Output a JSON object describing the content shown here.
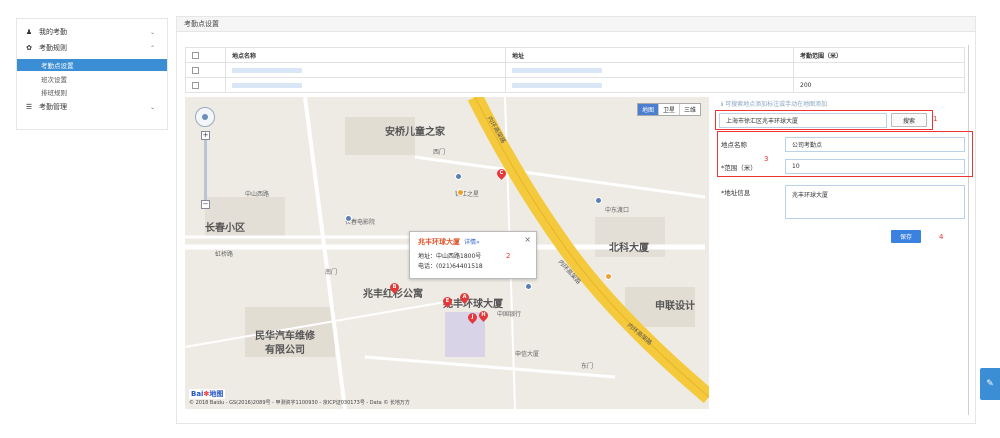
{
  "sidebar": {
    "items": [
      {
        "label": "我的考勤",
        "icon": "user-icon"
      },
      {
        "label": "考勤规则",
        "icon": "gear-icon"
      },
      {
        "label": "考勤管理",
        "icon": "list-icon"
      }
    ],
    "sub_items": [
      {
        "label": "考勤点设置",
        "active": true
      },
      {
        "label": "班次设置",
        "active": false
      },
      {
        "label": "排班规则",
        "active": false
      }
    ]
  },
  "main": {
    "title": "考勤点设置",
    "table": {
      "headers": [
        "",
        "地点名称",
        "地址",
        "考勤范围（米）"
      ],
      "rows": [
        {
          "range": ""
        },
        {
          "range": "200"
        }
      ]
    }
  },
  "map": {
    "type_buttons": [
      "地图",
      "卫星",
      "三维"
    ],
    "popup": {
      "title": "兆丰环球大厦",
      "detail_link": "详情»",
      "address": "地址：中山西路1800号",
      "phone": "电话：(021)64401518",
      "close": "×",
      "annotation": "2"
    },
    "labels": {
      "anqiao": "安桥儿童之家",
      "changchun": "长春小区",
      "zhaofeng_garden": "兆丰红杉公寓",
      "zhaofeng_tower": "兆丰环球大厦",
      "minhua": "民华汽车维修",
      "minhua2": "有限公司",
      "beike": "北科大厦",
      "dongcheng": "中东渡口",
      "innerring1": "内环高架路",
      "innerring2": "内环高架路",
      "innerring3": "内环高架路",
      "zhongshan": "中山西路",
      "yanzhou": "虹桥路",
      "gate": "西门",
      "gate2": "南门",
      "gate3": "东门",
      "bank": "中国银行",
      "shenxin": "申信大厦",
      "design": "申联设计",
      "cinema": "长春电影院",
      "hotel": "锦江之星"
    },
    "copyright": "© 2018 Baidu - GS(2016)2089号 - 甲测资字1100930 - 京ICP证030173号 - Data © 长地万方",
    "logo_text": "Bai",
    "logo_text2": "地图"
  },
  "form": {
    "hint": "ℹ 可搜索地点添加标注或手动在地图添加",
    "search_value": "上海市徐汇区兆丰环球大厦",
    "search_button": "搜索",
    "name_label": "地点名称",
    "name_value": "公司考勤点",
    "range_label": "*范围（米）",
    "range_value": "10",
    "address_label": "*地址信息",
    "address_value": "兆丰环球大厦",
    "save_button": "保存",
    "annotations": [
      "1",
      "3",
      "4"
    ]
  },
  "float_button_icon": "edit-icon"
}
